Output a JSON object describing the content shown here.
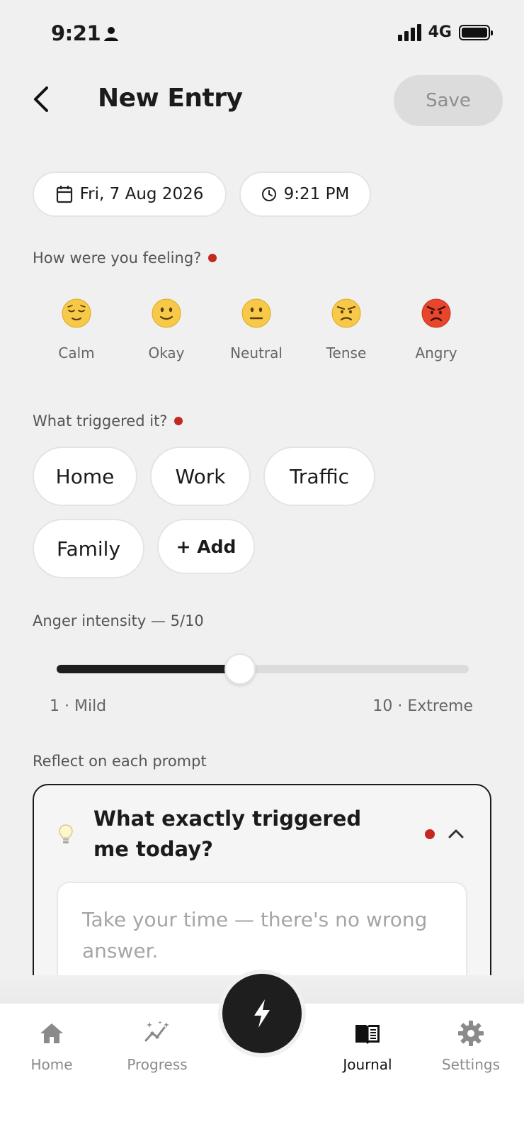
{
  "status_bar": {
    "time": "9:21",
    "network": "4G"
  },
  "header": {
    "title": "New Entry",
    "save_label": "Save"
  },
  "entry": {
    "date": "Fri, 7 Aug 2026",
    "time": "9:21 PM"
  },
  "mood_section": {
    "label": "How were you feeling?",
    "options": [
      {
        "label": "Calm",
        "icon": "relieved-face-icon"
      },
      {
        "label": "Okay",
        "icon": "slightly-smiling-face-icon"
      },
      {
        "label": "Neutral",
        "icon": "neutral-face-icon"
      },
      {
        "label": "Tense",
        "icon": "annoyed-face-icon"
      },
      {
        "label": "Angry",
        "icon": "angry-face-icon"
      }
    ]
  },
  "trigger_section": {
    "label": "What triggered it?",
    "chips": [
      "Home",
      "Work",
      "Traffic",
      "Family"
    ],
    "add_label": "+ Add"
  },
  "intensity": {
    "label": "Anger intensity — 5/10",
    "value": 5,
    "min": 1,
    "max": 10,
    "min_label": "1 · Mild",
    "max_label": "10 · Extreme"
  },
  "reflect_section": {
    "label": "Reflect on each prompt",
    "prompt": {
      "question": "What exactly triggered me today?",
      "placeholder": "Take your time — there's no wrong answer."
    }
  },
  "tab_bar": {
    "tabs": [
      {
        "label": "Home",
        "icon": "home-icon",
        "active": false
      },
      {
        "label": "Progress",
        "icon": "progress-chart-icon",
        "active": false
      },
      {
        "label": "Journal",
        "icon": "journal-book-icon",
        "active": true
      },
      {
        "label": "Settings",
        "icon": "gear-icon",
        "active": false
      }
    ],
    "fab_icon": "lightning-icon"
  },
  "colors": {
    "accent": "#1e1e1e",
    "required_dot": "#c42820",
    "background": "#f0f0f0"
  }
}
